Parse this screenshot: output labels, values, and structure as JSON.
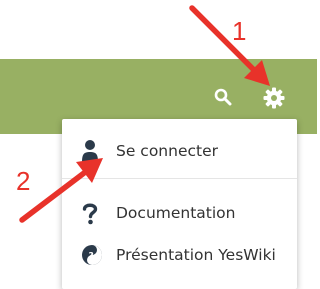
{
  "navbar": {
    "background": "#98b063",
    "icons": [
      "search-icon",
      "gear-icon"
    ]
  },
  "dropdown": {
    "items": [
      {
        "label": "Se connecter",
        "icon": "user-icon"
      },
      {
        "label": "Documentation",
        "icon": "question-icon"
      },
      {
        "label": "Présentation YesWiki",
        "icon": "yeswiki-icon"
      }
    ]
  },
  "annotations": {
    "color": "#e8322a",
    "step1": "1",
    "step2": "2"
  }
}
